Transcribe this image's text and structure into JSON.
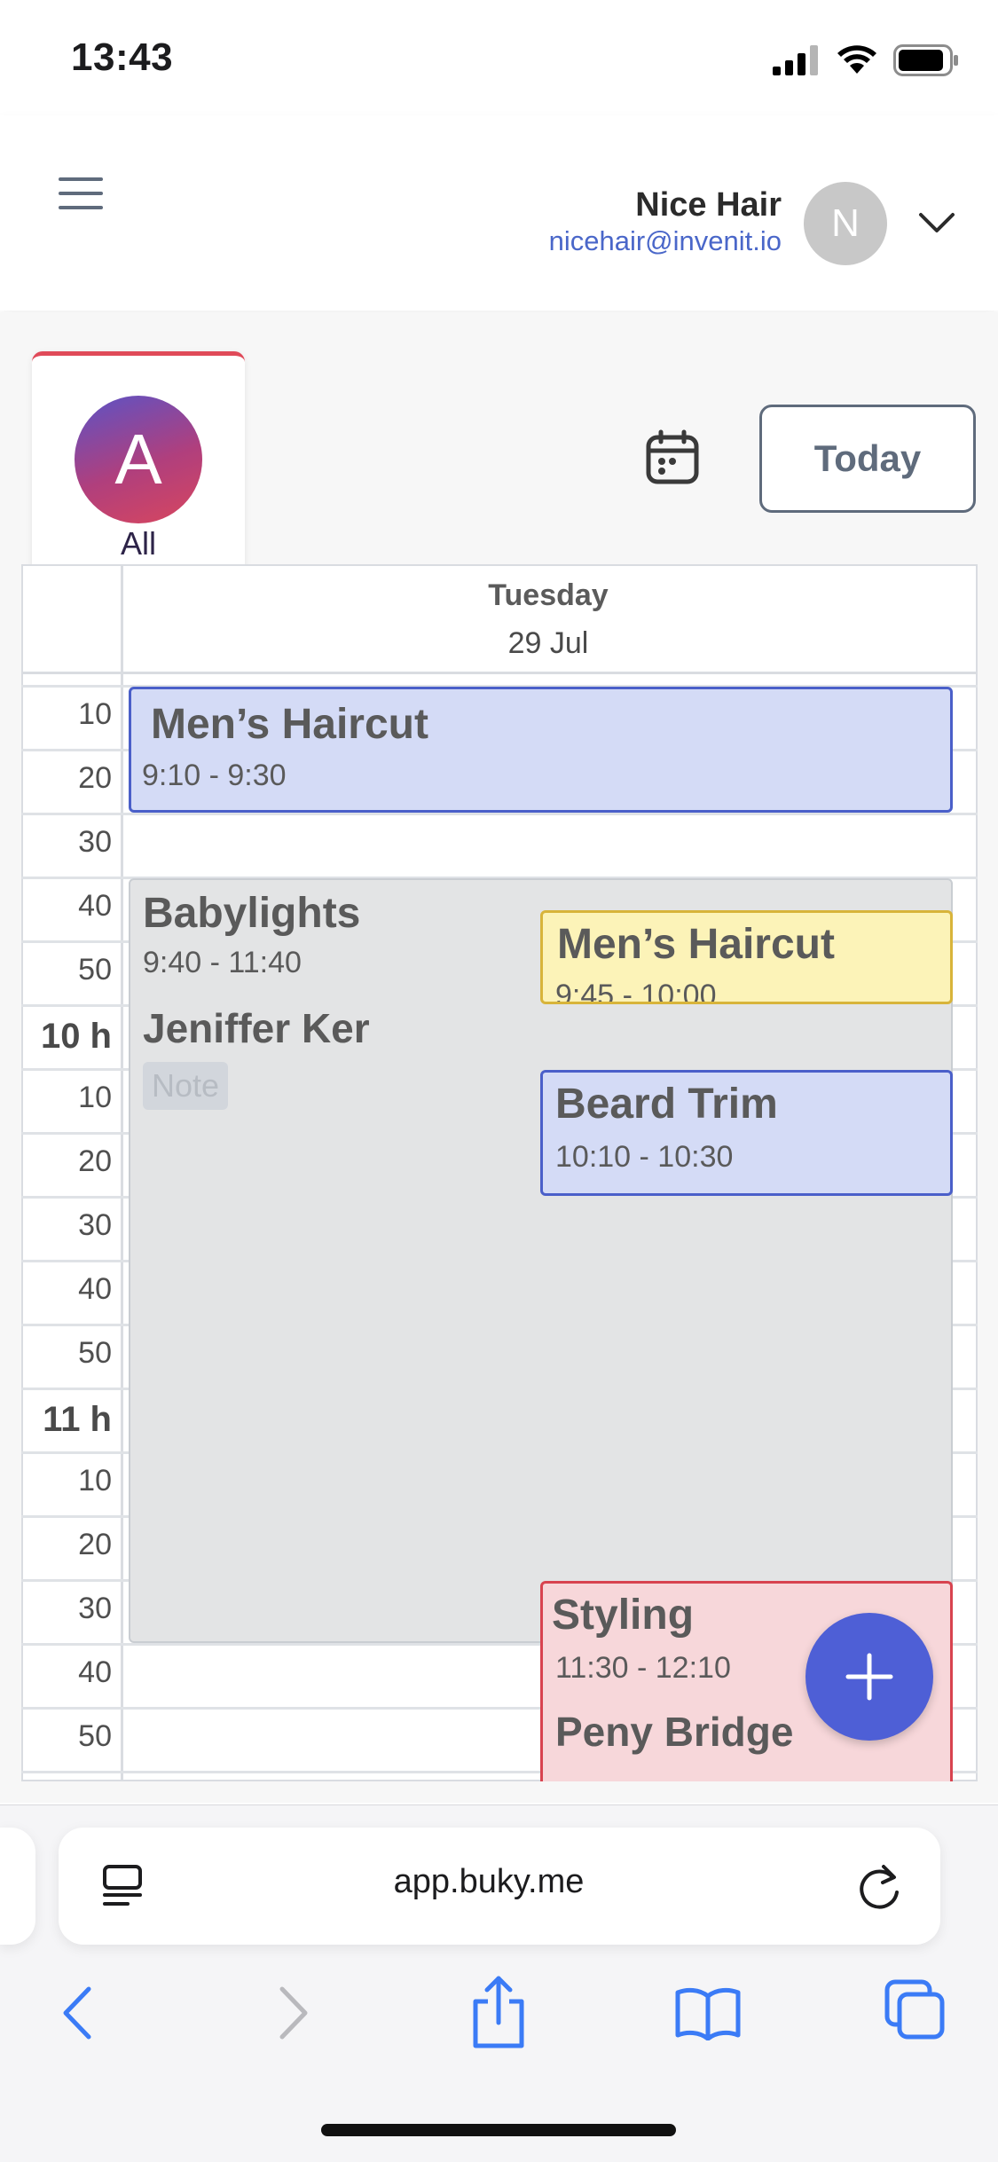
{
  "status_bar": {
    "time": "13:43"
  },
  "header": {
    "user_name": "Nice Hair",
    "user_email": "nicehair@invenit.io",
    "avatar_initial": "N"
  },
  "staff_filter": {
    "initial": "A",
    "label": "All",
    "accent": "#e04a59"
  },
  "toolbar": {
    "today_label": "Today"
  },
  "day": {
    "name": "Tuesday",
    "date": "29 Jul"
  },
  "time_slots": [
    "10",
    "20",
    "30",
    "40",
    "50",
    "10 h",
    "10",
    "20",
    "30",
    "40",
    "50",
    "11 h",
    "10",
    "20",
    "30",
    "40",
    "50"
  ],
  "appointments": [
    {
      "title": "Men’s Haircut",
      "time": "9:10 - 9:30",
      "color": "#d4dbf6",
      "border": "#4a5fc9"
    },
    {
      "title": "Babylights",
      "time": "9:40 - 11:40",
      "client": "Jeniffer Ker",
      "note": "Note",
      "color": "#e3e4e5",
      "border": "#c9cdd2"
    },
    {
      "title": "Men’s Haircut",
      "time": "9:45 - 10:00",
      "color": "#fcf3b8",
      "border": "#d8b43a"
    },
    {
      "title": "Beard Trim",
      "time": "10:10 - 10:30",
      "color": "#d4dbf6",
      "border": "#4a5fc9"
    },
    {
      "title": "Styling",
      "time": "11:30 - 12:10",
      "client": "Peny Bridge",
      "color": "#f7d7da",
      "border": "#d8434f"
    }
  ],
  "browser": {
    "url": "app.buky.me"
  },
  "fab_color": "#4e5fd6"
}
